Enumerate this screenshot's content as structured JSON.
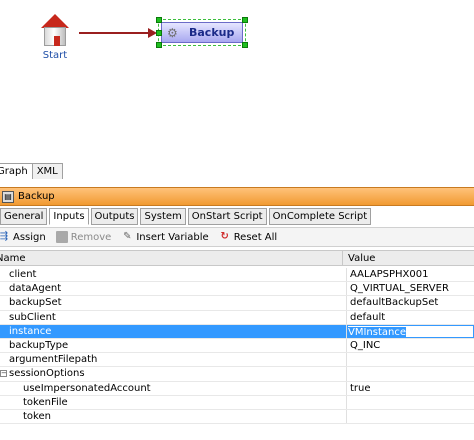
{
  "canvas": {
    "start_node": {
      "label": "Start"
    },
    "backup_node": {
      "label": "Backup"
    }
  },
  "view_tabs": [
    {
      "label": "Graph",
      "active": true
    },
    {
      "label": "XML",
      "active": false
    }
  ],
  "panel": {
    "title": "Backup"
  },
  "prop_tabs": [
    {
      "label": "General",
      "active": false
    },
    {
      "label": "Inputs",
      "active": true
    },
    {
      "label": "Outputs",
      "active": false
    },
    {
      "label": "System",
      "active": false
    },
    {
      "label": "OnStart Script",
      "active": false
    },
    {
      "label": "OnComplete Script",
      "active": false
    }
  ],
  "toolbar": {
    "assign_label": "Assign",
    "remove_label": "Remove",
    "insert_variable_label": "Insert Variable",
    "reset_all_label": "Reset All"
  },
  "grid": {
    "columns": {
      "name": "Name",
      "value": "Value"
    },
    "rows": [
      {
        "name": "client",
        "value": "AALAPSPHX001",
        "level": 1
      },
      {
        "name": "dataAgent",
        "value": "Q_VIRTUAL_SERVER",
        "level": 1
      },
      {
        "name": "backupSet",
        "value": "defaultBackupSet",
        "level": 1
      },
      {
        "name": "subClient",
        "value": "default",
        "level": 1
      },
      {
        "name": "instance",
        "value": "VMInstance",
        "level": 1,
        "selected": true
      },
      {
        "name": "backupType",
        "value": "Q_INC",
        "level": 1
      },
      {
        "name": "argumentFilepath",
        "value": "",
        "level": 1
      },
      {
        "name": "sessionOptions",
        "value": "",
        "level": 0,
        "group": true
      },
      {
        "name": "useImpersonatedAccount",
        "value": "true",
        "level": 2
      },
      {
        "name": "tokenFile",
        "value": "",
        "level": 2
      },
      {
        "name": "token",
        "value": "",
        "level": 2
      }
    ]
  },
  "colors": {
    "title_bar": "#f19a32",
    "selection": "#3399ff",
    "connector": "#9a1f1f",
    "node_fill": "#a8a8f0",
    "node_selection_handle": "#1fbf1f"
  }
}
